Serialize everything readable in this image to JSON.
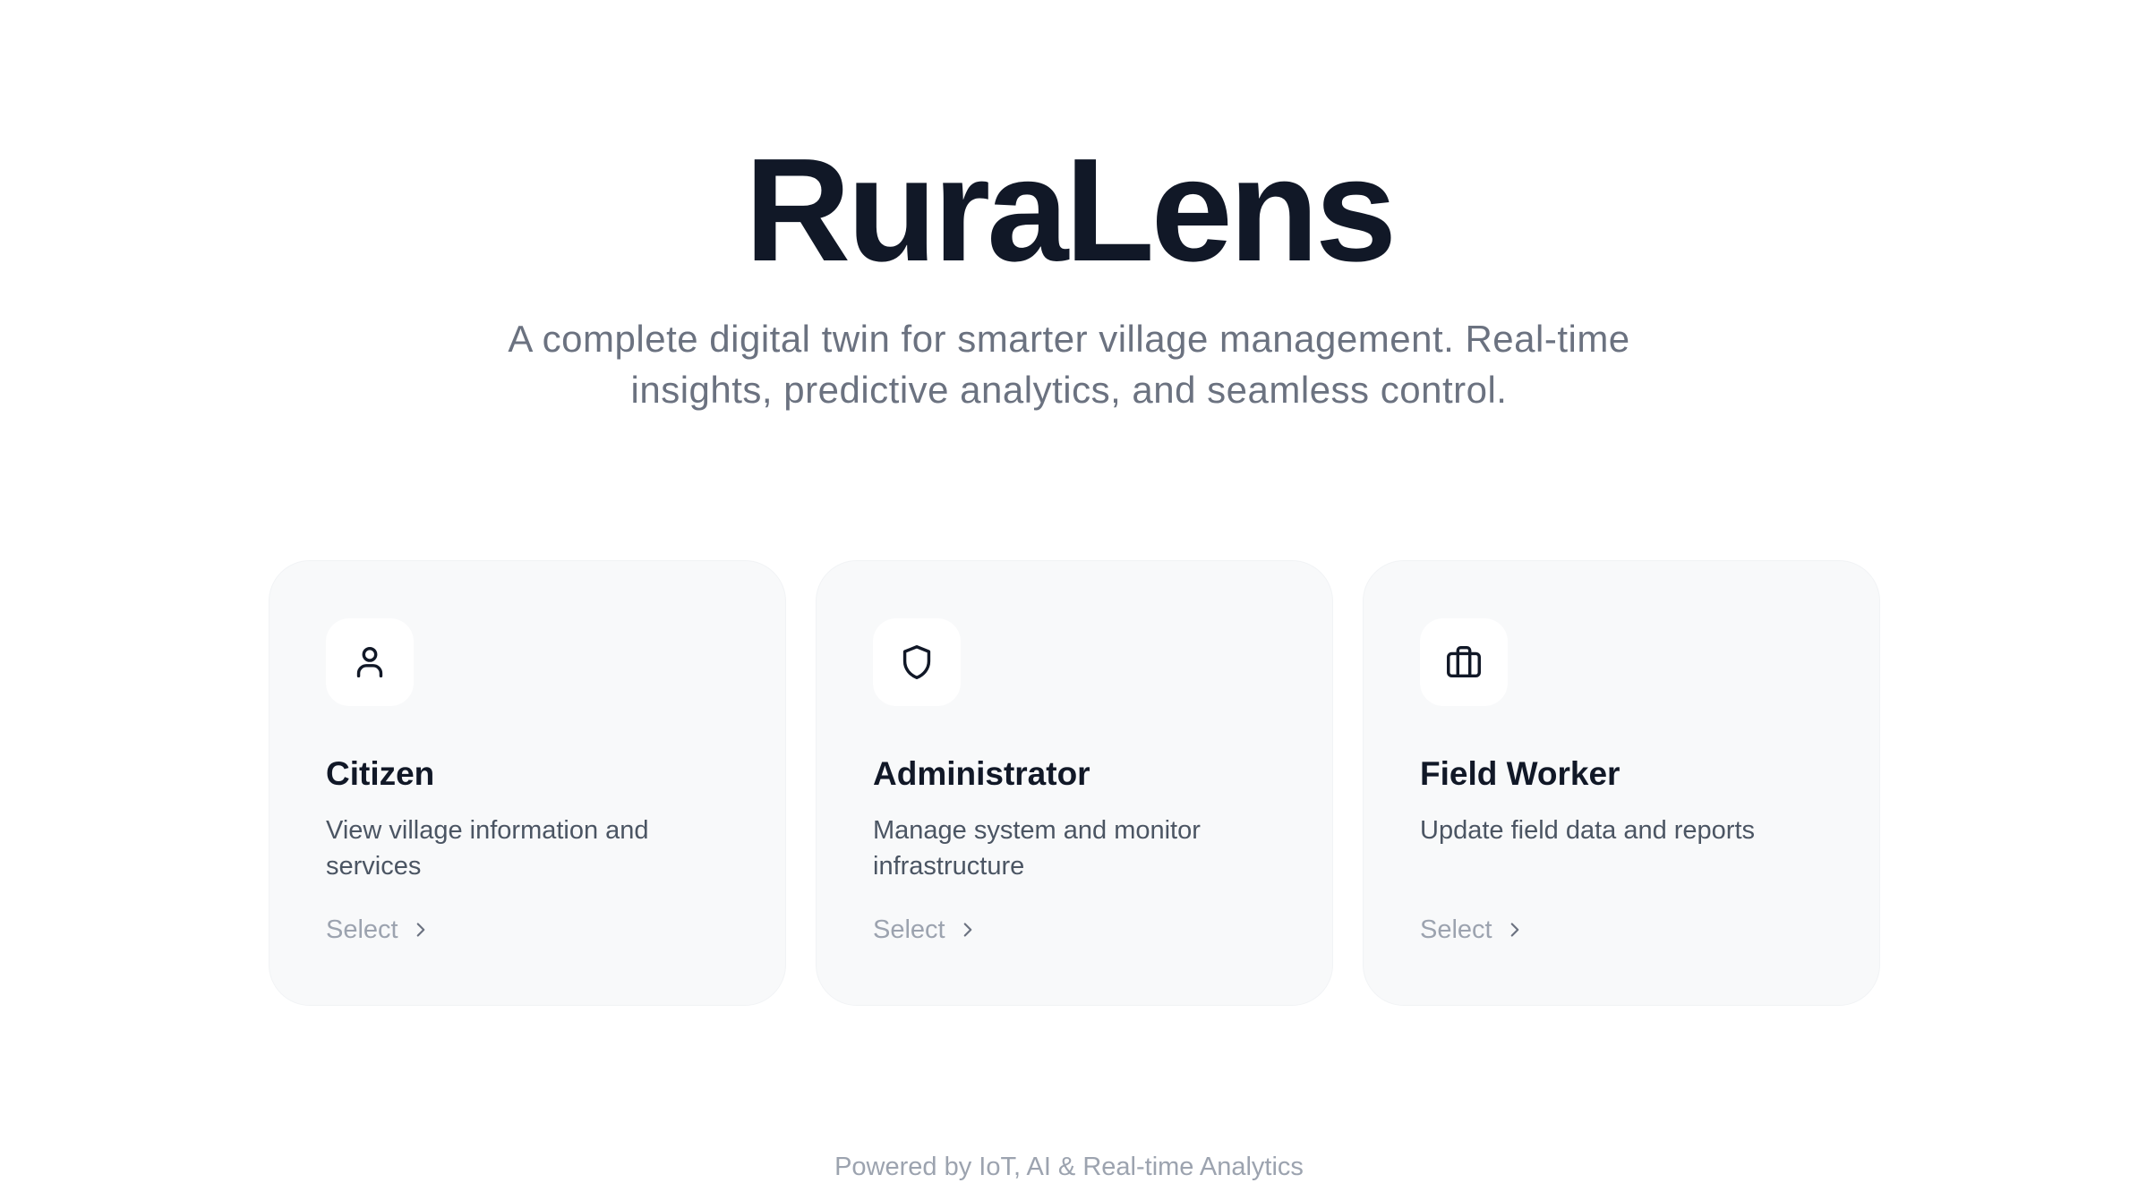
{
  "hero": {
    "title": "RuraLens",
    "subtitle": "A complete digital twin for smarter village management. Real-time insights, predictive analytics, and seamless control."
  },
  "roles": [
    {
      "title": "Citizen",
      "description": "View village information and services",
      "action_label": "Select",
      "icon": "user-icon"
    },
    {
      "title": "Administrator",
      "description": "Manage system and monitor infrastructure",
      "action_label": "Select",
      "icon": "shield-icon"
    },
    {
      "title": "Field Worker",
      "description": "Update field data and reports",
      "action_label": "Select",
      "icon": "briefcase-icon"
    }
  ],
  "footer": {
    "text": "Powered by IoT, AI & Real-time Analytics"
  },
  "colors": {
    "heading": "#111827",
    "body_text": "#4b5563",
    "muted": "#9ca3af",
    "card_bg": "#f8f9fa"
  }
}
